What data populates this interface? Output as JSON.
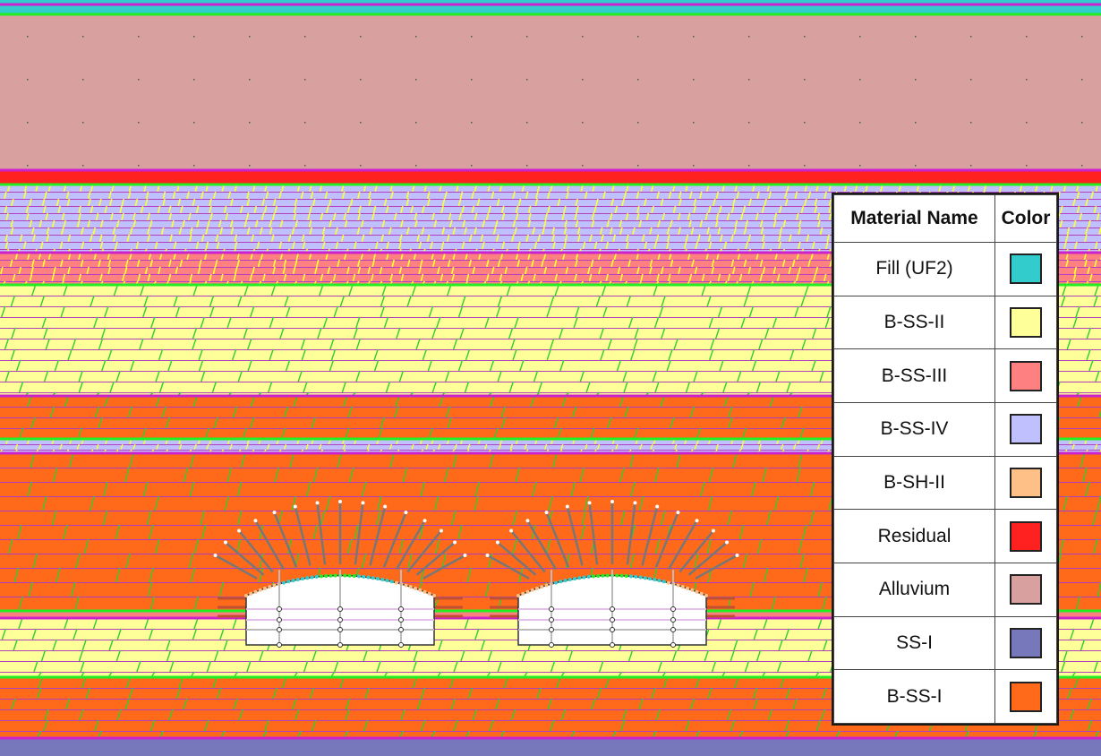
{
  "legend": {
    "header": {
      "name": "Material Name",
      "color": "Color"
    },
    "materials": [
      {
        "name": "Fill (UF2)",
        "color": "#33cccc"
      },
      {
        "name": "B-SS-II",
        "color": "#ffff99"
      },
      {
        "name": "B-SS-III",
        "color": "#ff8080"
      },
      {
        "name": "B-SS-IV",
        "color": "#c0c0ff"
      },
      {
        "name": "B-SH-II",
        "color": "#ffc088"
      },
      {
        "name": "Residual",
        "color": "#ff2020"
      },
      {
        "name": "Alluvium",
        "color": "#d9a0a0"
      },
      {
        "name": "SS-I",
        "color": "#7777bb"
      },
      {
        "name": "B-SS-I",
        "color": "#ff6a1a"
      }
    ]
  },
  "colors": {
    "boundary_green": "#22ee22",
    "boundary_magenta": "#cc22cc",
    "joint_green": "#33cc33",
    "joint_yellow": "#ffff33",
    "bolt": "#777777",
    "excavation": "#ffffff"
  }
}
